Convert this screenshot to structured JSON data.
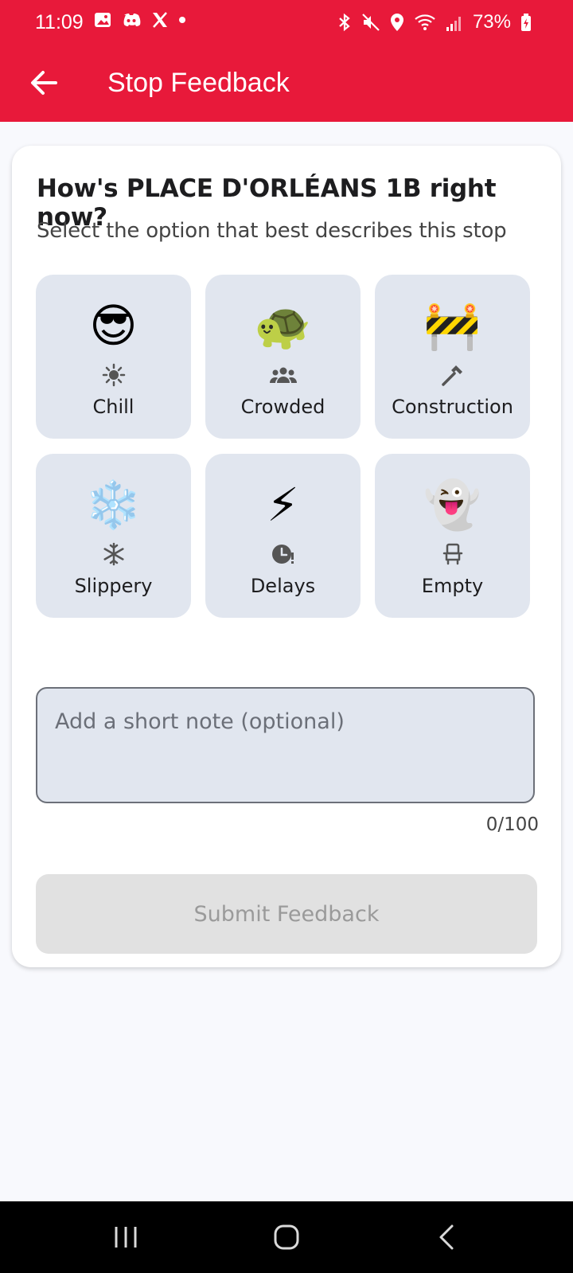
{
  "status_bar": {
    "time": "11:09",
    "battery": "73%",
    "left_icons": [
      "gallery-icon",
      "discord-icon",
      "x-icon",
      "dot-icon"
    ],
    "right_icons": [
      "bluetooth-icon",
      "mute-icon",
      "location-icon",
      "wifi-icon",
      "signal-icon"
    ]
  },
  "appbar": {
    "title": "Stop Feedback",
    "color": "#e8193a"
  },
  "card": {
    "title": "How's PLACE D'ORLÉANS 1B right now?",
    "subtitle": "Select the option that best describes this stop"
  },
  "options": [
    {
      "label": "Chill",
      "emoji": "😎",
      "icon": "sun-icon"
    },
    {
      "label": "Crowded",
      "emoji": "🐢",
      "icon": "group-icon"
    },
    {
      "label": "Construction",
      "emoji": "🚧",
      "icon": "hammer-icon"
    },
    {
      "label": "Slippery",
      "emoji": "❄️",
      "icon": "snowflake-icon"
    },
    {
      "label": "Delays",
      "emoji": "⚡",
      "icon": "clock-alert-icon"
    },
    {
      "label": "Empty",
      "emoji": "👻",
      "icon": "empty-seat-icon"
    }
  ],
  "note": {
    "placeholder": "Add a short note (optional)",
    "value": "",
    "counter": "0/100"
  },
  "submit": {
    "label": "Submit Feedback"
  },
  "nav": [
    "recents-icon",
    "home-icon",
    "back-icon"
  ]
}
